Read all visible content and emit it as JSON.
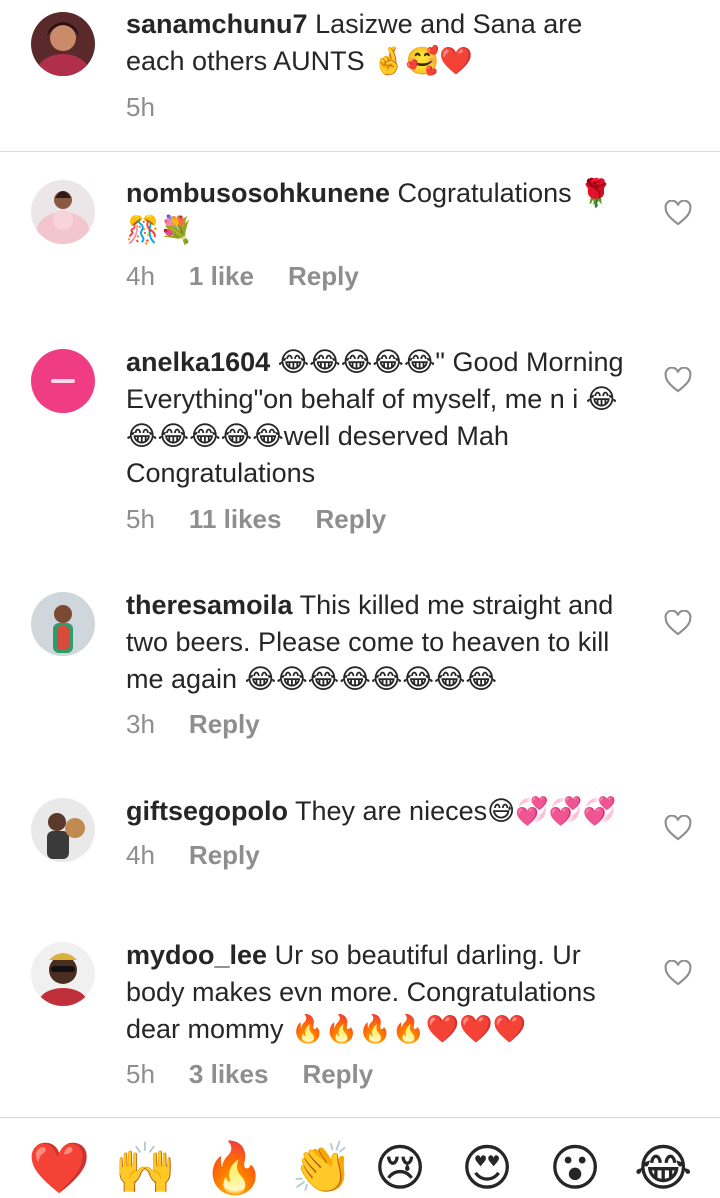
{
  "pinned": {
    "username": "sanamchunu7",
    "text": " Lasizwe and Sana are each others AUNTS 🤞🥰❤️",
    "time": "5h"
  },
  "comments": [
    {
      "username": "nombusosohkunene",
      "text": " Cogratulations 🌹🎊💐",
      "time": "4h",
      "likes": "1 like",
      "reply": "Reply"
    },
    {
      "username": "anelka1604",
      "text": " 😂😂😂😂😂\" Good Morning Everything\"on behalf of myself, me n i 😂😂😂😂😂😂well deserved Mah Congratulations",
      "time": "5h",
      "likes": "11 likes",
      "reply": "Reply"
    },
    {
      "username": "theresamoila",
      "text": " This killed me straight and two beers. Please come to heaven to kill me again 😂😂😂😂😂😂😂😂",
      "time": "3h",
      "reply": "Reply"
    },
    {
      "username": "giftsegopolo",
      "text": " They are nieces😅💞💞💞",
      "time": "4h",
      "reply": "Reply"
    },
    {
      "username": "mydoo_lee",
      "text": " Ur so beautiful darling. Ur body makes evn more. Congratulations dear mommy 🔥🔥🔥🔥❤️❤️❤️",
      "time": "5h",
      "likes": "3 likes",
      "reply": "Reply"
    }
  ],
  "reactions": [
    "❤️",
    "🙌",
    "🔥",
    "👏",
    "😢",
    "😍",
    "😮",
    "😂"
  ],
  "icons": {
    "like": "heart-outline-icon"
  },
  "colors": {
    "text": "#262626",
    "meta": "#8e8e8e",
    "divider": "#dbdbdb"
  }
}
